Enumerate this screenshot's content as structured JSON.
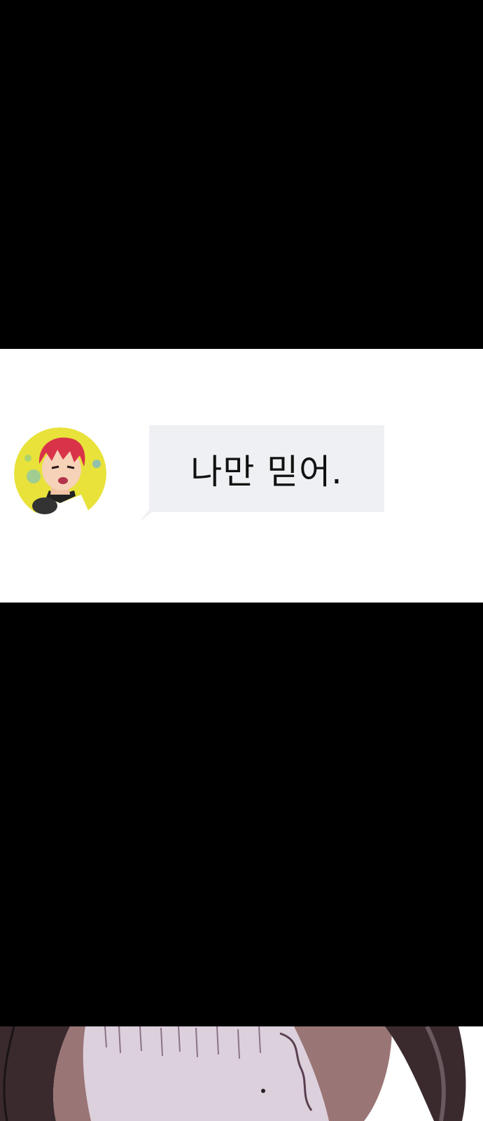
{
  "message": {
    "text": "나만 믿어.",
    "bubble_color": "#eef0f3",
    "text_color": "#111111"
  },
  "avatar": {
    "icon": "character-avatar-icon",
    "background_color": "#e8e23a",
    "hair_color": "#d9334a"
  },
  "colors": {
    "background_black": "#000000",
    "panel_white": "#ffffff"
  }
}
